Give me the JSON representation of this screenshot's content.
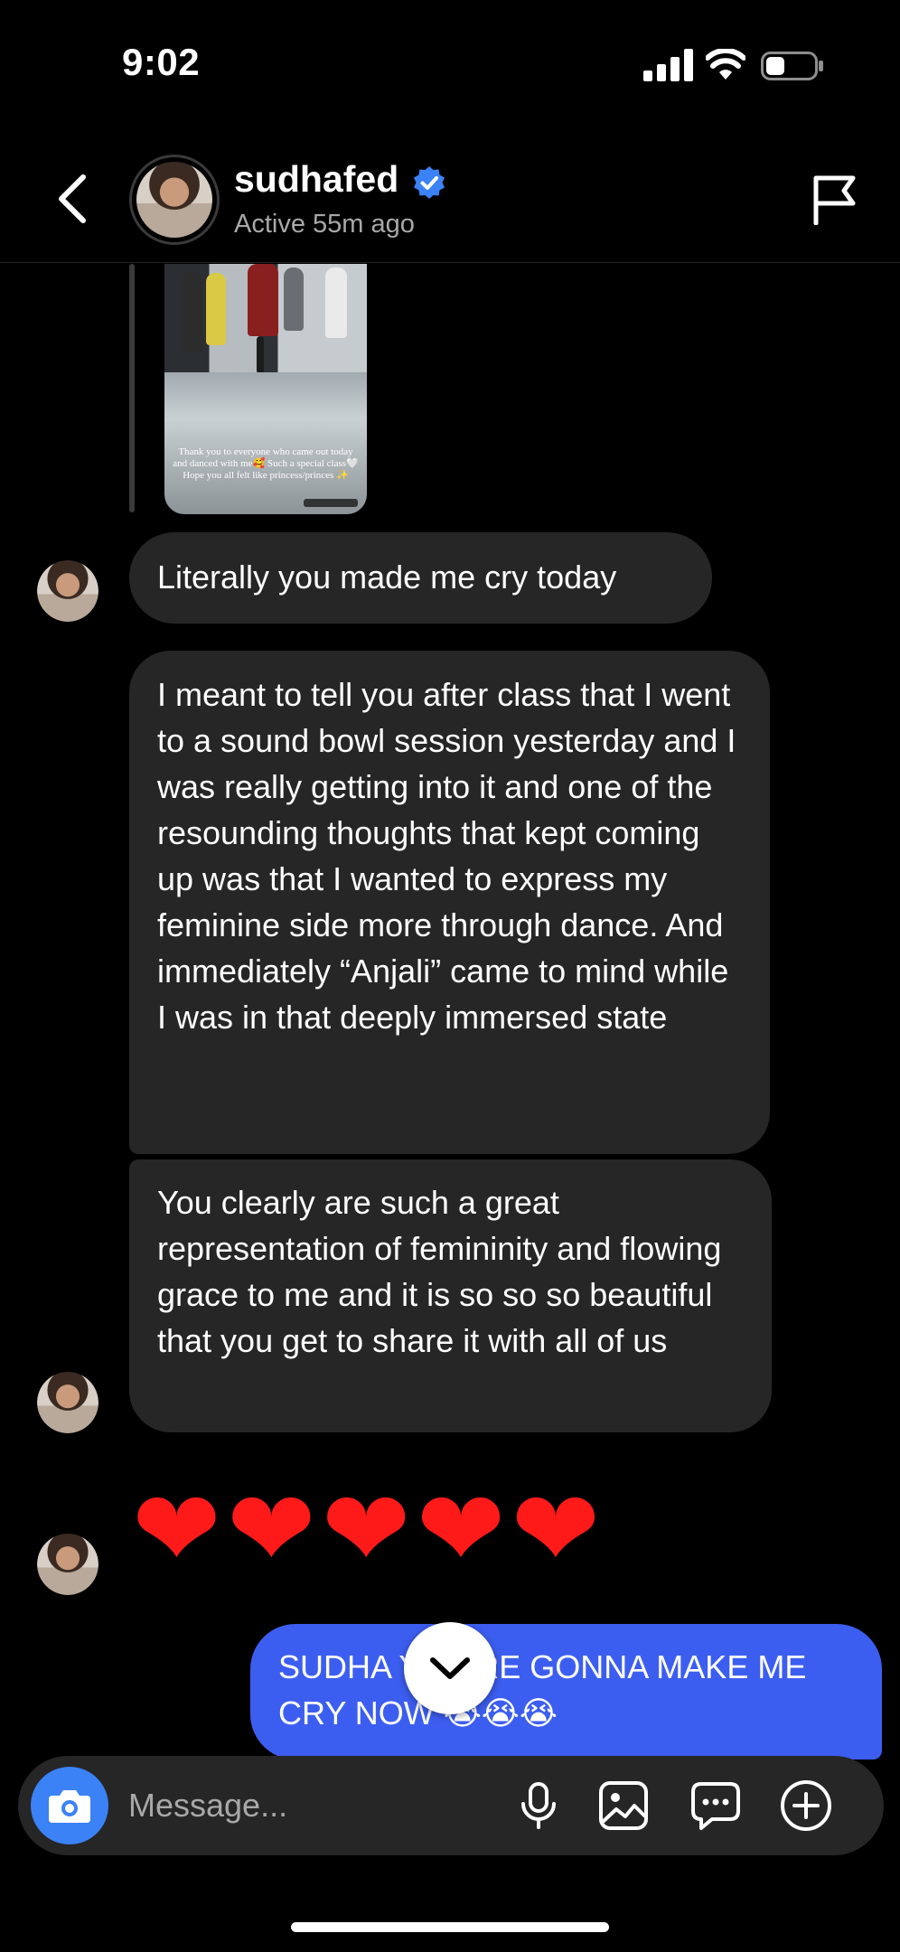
{
  "status_bar": {
    "time": "9:02"
  },
  "header": {
    "username": "sudhafed",
    "active_status": "Active 55m ago"
  },
  "story": {
    "caption": "Thank you to everyone who came out today and danced with me🥰 Such a special class🤍 Hope you all felt like princess/princes ✨"
  },
  "messages": {
    "msg1": "Literally you made me cry today",
    "msg2": "I meant to tell you after class that I went to a sound bowl session yesterday and I was really getting into it and one of the resounding thoughts that kept coming up was that I wanted to express my feminine side more through dance. And immediately “Anjali” came to mind while I was in that deeply immersed state",
    "msg3": "You clearly are such a great representation of femininity and flowing grace to me and it is so so so beautiful that you get to share it with all of us",
    "hearts": "❤❤❤❤❤",
    "sent": "SUDHA YOU'RE GONNA MAKE ME CRY NOW 😭😭😭"
  },
  "composer": {
    "placeholder": "Message..."
  },
  "colors": {
    "background": "#000000",
    "bubble_received": "#262626",
    "bubble_sent": "#3c5ef0",
    "verified": "#3b82f6",
    "camera_button": "#3b82f6",
    "secondary_text": "#a8a8a8"
  },
  "icons": {
    "back": "chevron-left-icon",
    "verified": "verified-badge-icon",
    "flag": "flag-icon",
    "camera": "camera-icon",
    "mic": "microphone-icon",
    "gallery": "image-icon",
    "chat": "message-bubble-icon",
    "plus": "plus-circle-icon",
    "scroll_down": "chevron-down-icon"
  }
}
